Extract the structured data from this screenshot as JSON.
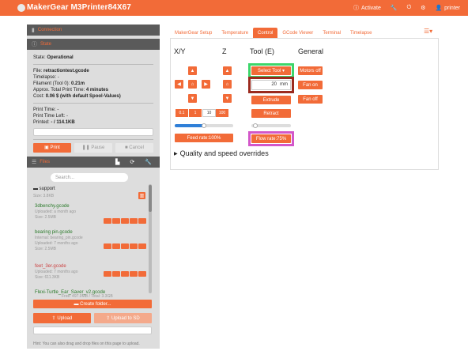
{
  "nav": {
    "brand": "MakerGear M3Printer84X67",
    "activate": "Activate",
    "user": "printer"
  },
  "connection": {
    "header": "Connection"
  },
  "state": {
    "header": "State",
    "state_label": "State:",
    "state_value": "Operational",
    "file_label": "File:",
    "file_value": "retractiontest.gcode",
    "timelapse": "Timelapse: -",
    "filament_label": "Filament (Tool 0):",
    "filament_value": "0.21m",
    "approx_label": "Approx. Total Print Time:",
    "approx_value": "4 minutes",
    "cost_label": "Cost:",
    "cost_value": "0.06 $ (with default Spool-Values)",
    "print_time": "Print Time: -",
    "print_time_left": "Print Time Left: -",
    "printed_label": "Printed:",
    "printed_value": "- / 114.1KB",
    "print_label": "Print",
    "pause_label": "Pause",
    "cancel_label": "Cancel"
  },
  "files": {
    "header": "Files",
    "search_placeholder": "Search...",
    "folder_name": "support",
    "folder_size": "Size: 3.8KB",
    "items": [
      {
        "name": "3dbenchy.gcode",
        "line1": "Uploaded: a month ago",
        "line2": "Size: 2.5MB"
      },
      {
        "name": "bearing pin.gcode",
        "line1": "Internal: bearing_pin.gcode",
        "line2": "Uploaded: 7 months ago",
        "line3": "Size: 2.5MB"
      },
      {
        "name": "feet_3er.gcode",
        "line1": "Uploaded: 7 months ago",
        "line2": "Size: 611.3KB"
      },
      {
        "name": "Flexi-Turtle_Ear_Saver_v2.gcode",
        "line1": "Free: 497.0MB / Total: 3.3GB"
      }
    ],
    "create_folder": "Create folder...",
    "upload": "Upload",
    "upload_sd": "Upload to SD",
    "hint": "Hint: You can also drag and drop files on this page to upload."
  },
  "tabs": [
    "MakerGear Setup",
    "Temperature",
    "Control",
    "GCode Viewer",
    "Terminal",
    "Timelapse"
  ],
  "control": {
    "xy": "X/Y",
    "z": "Z",
    "tool": "Tool (E)",
    "general": "General",
    "select_tool": "Select Tool",
    "extrude_amount": "20",
    "unit": "mm",
    "extrude": "Extrude",
    "retract": "Retract",
    "motors_off": "Motors off",
    "fan_on": "Fan on",
    "fan_off": "Fan off",
    "distances": [
      "0.1",
      "1",
      "10",
      "100"
    ],
    "selected_distance": "10",
    "feed_rate": "Feed rate:100%",
    "flow_rate": "Flow rate:75%",
    "feed_rate_level": 0.5,
    "flow_rate_level": 0.1,
    "quality": "Quality and speed overrides"
  },
  "colors": {
    "accent": "#f26b38",
    "highlight_green": "#3cd66a",
    "highlight_red": "#9b2a1e",
    "highlight_magenta": "#d357c9"
  }
}
